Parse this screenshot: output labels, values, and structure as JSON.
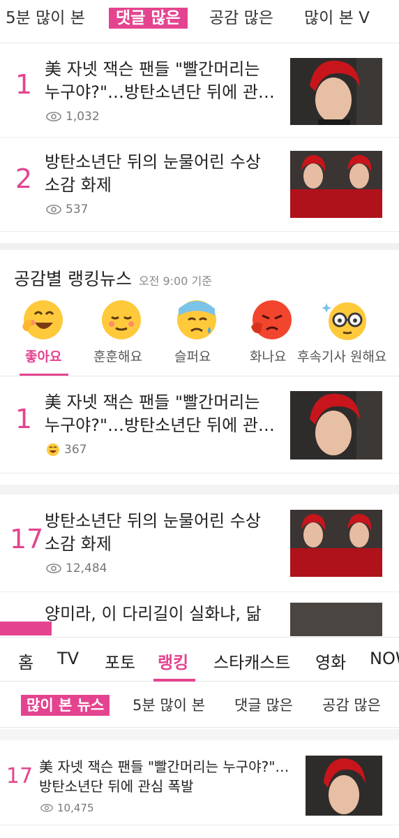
{
  "top_tabs": [
    {
      "label": "5분 많이 본"
    },
    {
      "label": "댓글 많은"
    },
    {
      "label": "공감 많은"
    },
    {
      "label": "많이 본 V"
    }
  ],
  "top_list": [
    {
      "rank": "1",
      "title_line1": "美 자넷 잭슨 팬들 \"빨간머리는",
      "title_line2": "누구야?\"…방탄소년단 뒤에 관…",
      "views": "1,032"
    },
    {
      "rank": "2",
      "title_line1": "방탄소년단 뒤의 눈물어린 수상",
      "title_line2": "소감 화제",
      "views": "537"
    }
  ],
  "ranking": {
    "title": "공감별 랭킹뉴스",
    "subtitle": "오전 9:00 기준",
    "emotions": [
      {
        "label": "좋아요",
        "icon": "laughing-face-icon"
      },
      {
        "label": "훈훈해요",
        "icon": "warm-face-icon"
      },
      {
        "label": "슬퍼요",
        "icon": "sad-face-icon"
      },
      {
        "label": "화나요",
        "icon": "angry-face-icon"
      },
      {
        "label": "후속기사 원해요",
        "icon": "glasses-face-icon"
      }
    ]
  },
  "emotion_list": [
    {
      "rank": "1",
      "title_line1": "美 자넷 잭슨 팬들 \"빨간머리는",
      "title_line2": "누구야?\"…방탄소년단 뒤에 관…",
      "count": "367"
    },
    {
      "rank": "17",
      "title_line1": "방탄소년단 뒤의 눈물어린 수상",
      "title_line2": "소감 화제",
      "views": "12,484"
    },
    {
      "title_line1": "양미라, 이 다리길이 실화냐, 닮"
    }
  ],
  "bottom_nav": [
    {
      "label": "홈"
    },
    {
      "label": "TV"
    },
    {
      "label": "포토"
    },
    {
      "label": "랭킹"
    },
    {
      "label": "스타캐스트"
    },
    {
      "label": "영화"
    },
    {
      "label": "NOW"
    }
  ],
  "sub_tabs": [
    {
      "label": "많이 본 뉴스"
    },
    {
      "label": "5분 많이 본"
    },
    {
      "label": "댓글 많은"
    },
    {
      "label": "공감 많은"
    }
  ],
  "bottom_item": {
    "rank": "17",
    "title_line1": "美 자넷 잭슨 팬들 \"빨간머리는 누구야?\"…",
    "title_line2": "방탄소년단 뒤에 관심 폭발",
    "views": "10,475"
  },
  "colors": {
    "accent": "#e4448f"
  }
}
